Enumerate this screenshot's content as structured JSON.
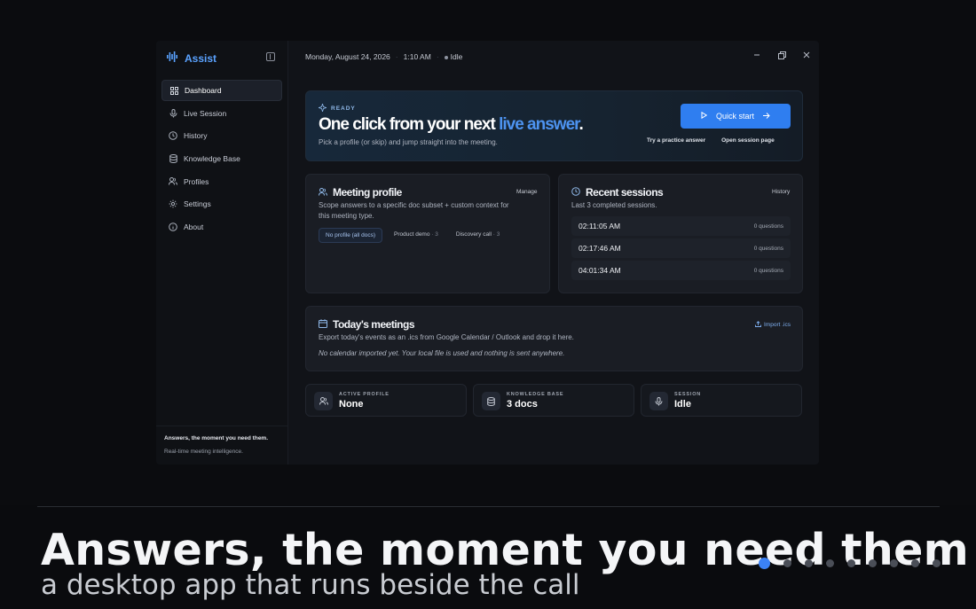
{
  "app": {
    "name": "Assist"
  },
  "sidebar": {
    "items": [
      {
        "label": "Dashboard",
        "icon": "grid-icon",
        "active": true
      },
      {
        "label": "Live Session",
        "icon": "mic-icon"
      },
      {
        "label": "History",
        "icon": "clock-icon"
      },
      {
        "label": "Knowledge Base",
        "icon": "database-icon"
      },
      {
        "label": "Profiles",
        "icon": "users-icon"
      },
      {
        "label": "Settings",
        "icon": "gear-icon"
      },
      {
        "label": "About",
        "icon": "info-icon"
      }
    ],
    "footer_title": "Answers, the moment you need them.",
    "footer_sub": "Real-time meeting intelligence."
  },
  "topbar": {
    "date": "Monday, August 24, 2026",
    "time": "1:10 AM",
    "status": "Idle"
  },
  "hero": {
    "badge": "READY",
    "title_main": "One click from your next ",
    "title_accent": "live answer",
    "title_end": ".",
    "subtitle": "Pick a profile (or skip) and jump straight into the meeting.",
    "quick_start": "Quick start",
    "link_practice": "Try a practice answer",
    "link_session": "Open session page"
  },
  "meeting_profile": {
    "title": "Meeting profile",
    "link": "Manage",
    "desc_line1": "Scope answers to a specific doc subset + custom context for",
    "desc_line2": "this meeting type.",
    "chips": [
      {
        "label": "No profile (all docs)",
        "count": ""
      },
      {
        "label": "Product demo",
        "count": "· 3"
      },
      {
        "label": "Discovery call",
        "count": "· 3"
      }
    ]
  },
  "recent_sessions": {
    "title": "Recent sessions",
    "link": "History",
    "desc": "Last 3 completed sessions.",
    "rows": [
      {
        "time": "02:11:05 AM",
        "questions": "0 questions"
      },
      {
        "time": "02:17:46 AM",
        "questions": "0 questions"
      },
      {
        "time": "04:01:34 AM",
        "questions": "0 questions"
      }
    ]
  },
  "meetings": {
    "title": "Today's meetings",
    "link": "Import .ics",
    "desc": "Export today's events as an .ics from Google Calendar / Outlook and drop it here.",
    "note": "No calendar imported yet. Your local file is used and nothing is sent anywhere."
  },
  "stats": [
    {
      "label": "ACTIVE PROFILE",
      "value": "None",
      "icon": "users-icon"
    },
    {
      "label": "KNOWLEDGE BASE",
      "value": "3 docs",
      "icon": "database-icon"
    },
    {
      "label": "SESSION",
      "value": "Idle",
      "icon": "mic-icon"
    }
  ],
  "caption": {
    "headline": "Answers, the moment you need them",
    "subline": "a desktop app that runs beside the call"
  },
  "pagination": {
    "total": 9,
    "current": 1
  },
  "colors": {
    "accent": "#2f7ef0",
    "accent_text": "#4d93f0",
    "bg": "#111318",
    "card": "#1a1d24"
  }
}
